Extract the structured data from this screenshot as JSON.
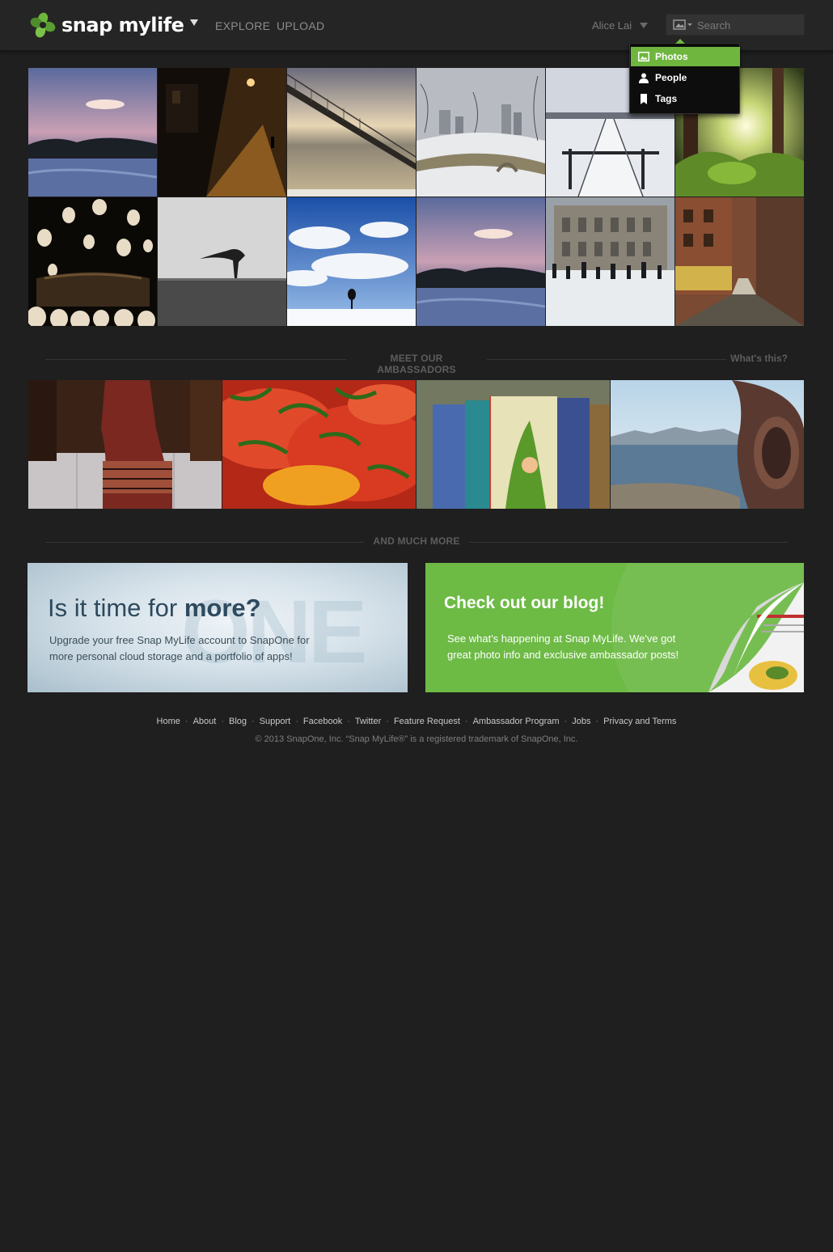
{
  "header": {
    "logo_text": "snap mylife",
    "nav": [
      {
        "label": "EXPLORE"
      },
      {
        "label": "UPLOAD"
      }
    ],
    "user_name": "Alice Lai",
    "search": {
      "placeholder": "Search",
      "value": ""
    },
    "search_menu": [
      {
        "label": "Photos",
        "icon": "image-icon",
        "active": true
      },
      {
        "label": "People",
        "icon": "person-icon",
        "active": false
      },
      {
        "label": "Tags",
        "icon": "tag-icon",
        "active": false
      }
    ]
  },
  "photos": [
    {
      "subject": "sunset-river"
    },
    {
      "subject": "night-alley"
    },
    {
      "subject": "suspension-bridge"
    },
    {
      "subject": "snowy-park-bridge"
    },
    {
      "subject": "snowy-pier"
    },
    {
      "subject": "forest-sunlight"
    },
    {
      "subject": "balloons-couch"
    },
    {
      "subject": "lone-tree"
    },
    {
      "subject": "tree-clouds"
    },
    {
      "subject": "sunset-river"
    },
    {
      "subject": "ice-rink"
    },
    {
      "subject": "city-street"
    }
  ],
  "ambassadors": {
    "title": "MEET OUR AMBASSADORS",
    "help_link": "What's this?",
    "items": [
      {
        "subject": "woman-in-dress"
      },
      {
        "subject": "tomato-salad"
      },
      {
        "subject": "childrens-books"
      },
      {
        "subject": "bay-viewer"
      }
    ]
  },
  "more": {
    "title": "AND MUCH MORE",
    "upgrade": {
      "headline_prefix": "Is it time for ",
      "headline_emphasis": "more?",
      "watermark": "ONE",
      "body": "Upgrade your free Snap MyLife account to SnapOne for more personal cloud storage and a portfolio of apps!"
    },
    "blog": {
      "headline": "Check out our blog!",
      "body": "See what's happening at Snap MyLife. We've got great photo info and exclusive ambassador posts!"
    }
  },
  "footer": {
    "links": [
      "Home",
      "About",
      "Blog",
      "Support",
      "Facebook",
      "Twitter",
      "Feature Request",
      "Ambassador Program",
      "Jobs",
      "Privacy and Terms"
    ],
    "copyright": "© 2013 SnapOne, Inc.  “Snap MyLife®” is a registered trademark of SnapOne, Inc."
  },
  "colors": {
    "background": "#1f1f1f",
    "header": "#252525",
    "accent_green": "#6fb63e",
    "blog_green": "#6dba45",
    "upgrade_text": "#2e4a5e"
  }
}
